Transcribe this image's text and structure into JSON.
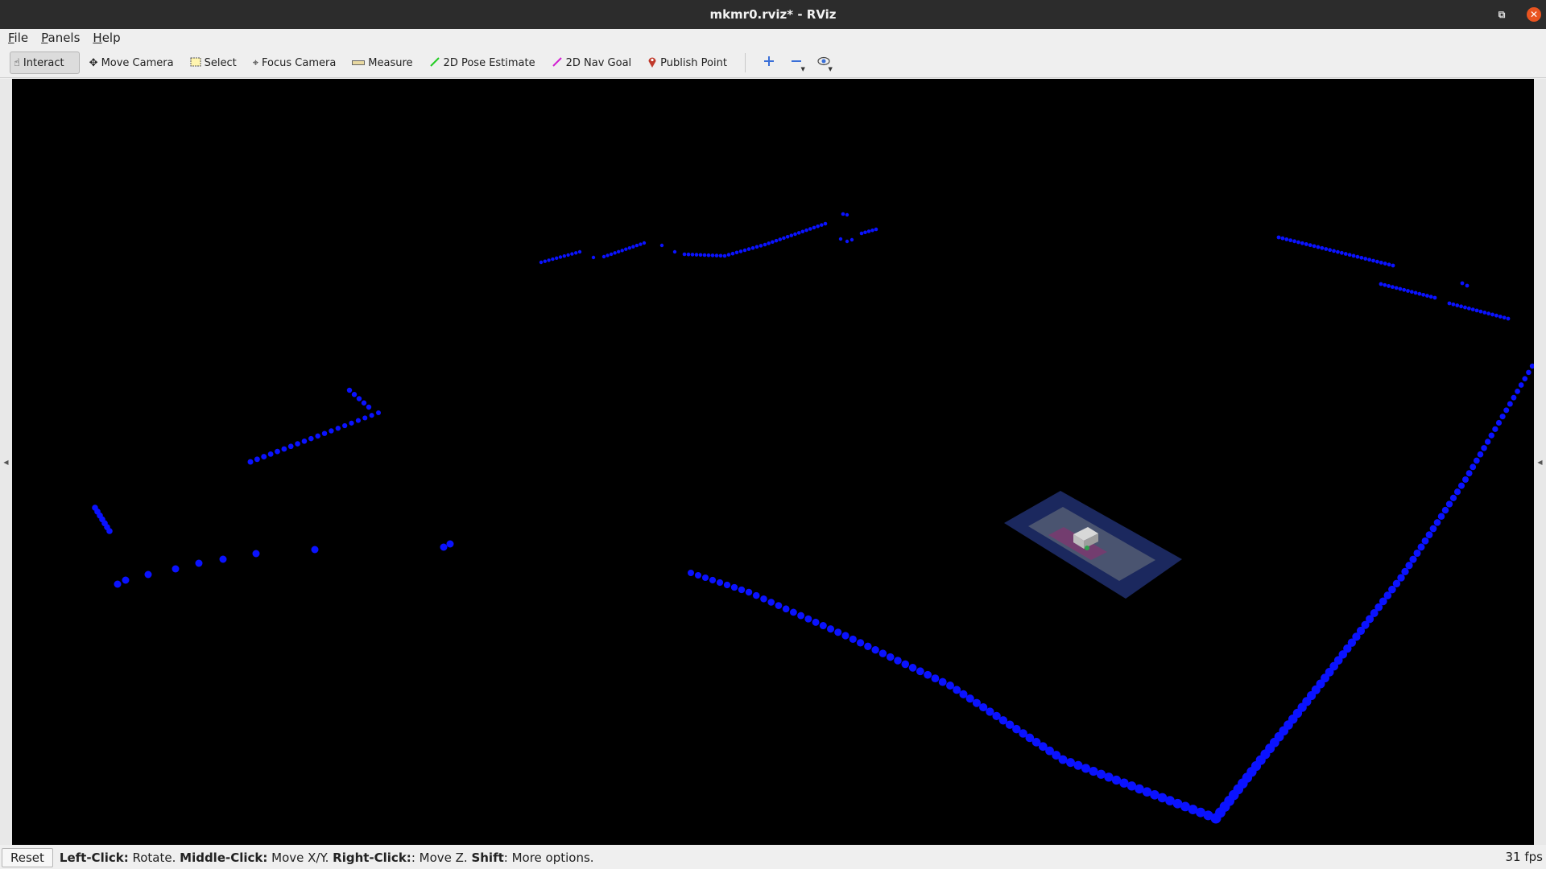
{
  "window": {
    "title": "mkmr0.rviz* - RViz",
    "restore_icon": "restore-icon",
    "close_icon": "close-icon"
  },
  "menu": [
    {
      "label_u": "F",
      "label_rest": "ile"
    },
    {
      "label_u": "P",
      "label_rest": "anels"
    },
    {
      "label_u": "H",
      "label_rest": "elp"
    }
  ],
  "toolbar": {
    "interact": "Interact",
    "move_camera": "Move Camera",
    "select": "Select",
    "focus_camera": "Focus Camera",
    "measure": "Measure",
    "pose_estimate": "2D Pose Estimate",
    "nav_goal": "2D Nav Goal",
    "publish_point": "Publish Point",
    "icons": [
      "add-tool-icon",
      "remove-tool-icon",
      "view-eye-icon"
    ]
  },
  "colors": {
    "laser_points": "#0a12ff",
    "pose_estimate_arrow": "#22cc22",
    "nav_goal_arrow": "#d21ed2",
    "publish_point_pin": "#c0392b",
    "viewport_bg": "#000000"
  },
  "status": {
    "reset_label": "Reset",
    "hint_parts": [
      {
        "b": "Left-Click:",
        "t": " Rotate. "
      },
      {
        "b": "Middle-Click:",
        "t": " Move X/Y. "
      },
      {
        "b": "Right-Click:",
        "t": ": Move Z. "
      },
      {
        "b": "Shift",
        "t": ": More options."
      }
    ],
    "fps": "31 fps"
  }
}
